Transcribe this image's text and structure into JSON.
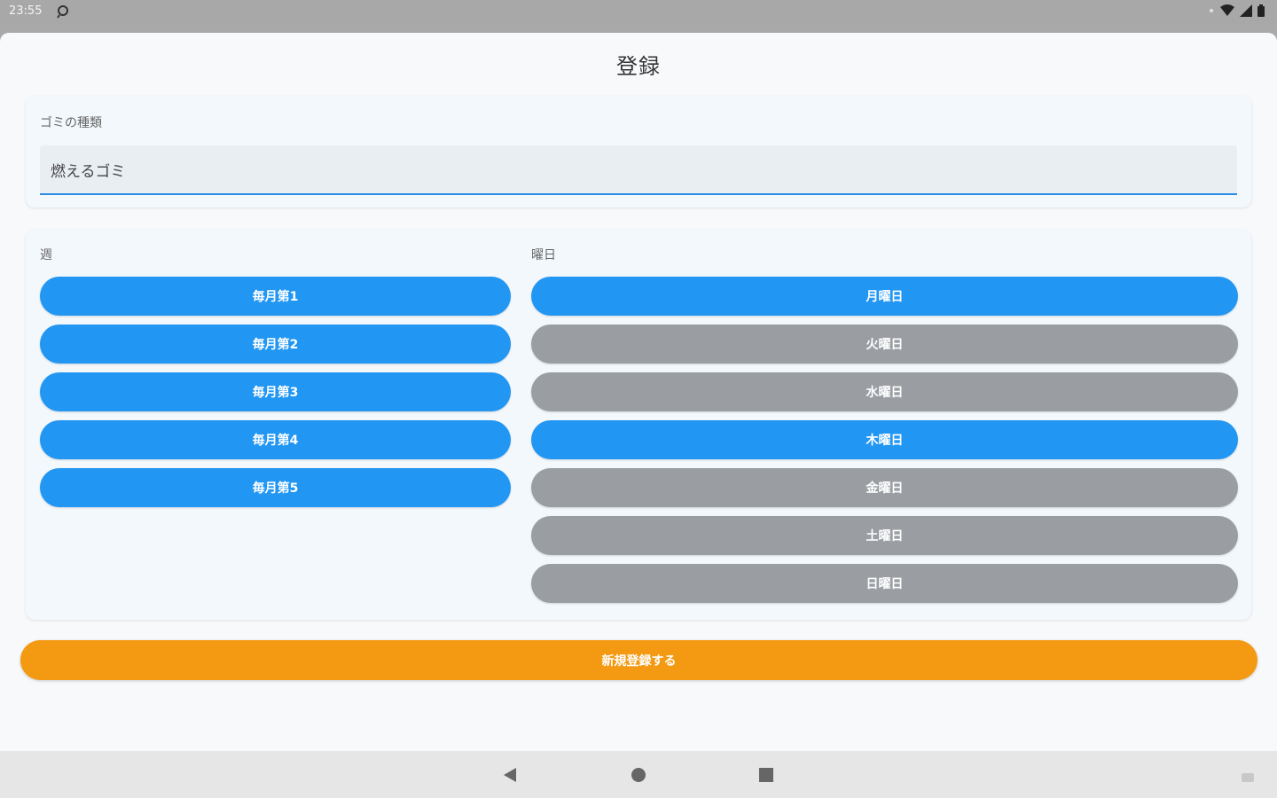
{
  "status_bar": {
    "time": "23:55",
    "left_icon": "sync-icon",
    "right_icons": [
      "notification-dot-icon",
      "wifi-icon",
      "signal-icon",
      "battery-icon"
    ]
  },
  "page": {
    "title": "登録"
  },
  "garbage_type": {
    "label": "ゴミの種類",
    "value": "燃えるゴミ"
  },
  "week": {
    "label": "週",
    "options": [
      {
        "label": "毎月第1",
        "selected": true
      },
      {
        "label": "毎月第2",
        "selected": true
      },
      {
        "label": "毎月第3",
        "selected": true
      },
      {
        "label": "毎月第4",
        "selected": true
      },
      {
        "label": "毎月第5",
        "selected": true
      }
    ]
  },
  "weekday": {
    "label": "曜日",
    "options": [
      {
        "label": "月曜日",
        "selected": true
      },
      {
        "label": "火曜日",
        "selected": false
      },
      {
        "label": "水曜日",
        "selected": false
      },
      {
        "label": "木曜日",
        "selected": true
      },
      {
        "label": "金曜日",
        "selected": false
      },
      {
        "label": "土曜日",
        "selected": false
      },
      {
        "label": "日曜日",
        "selected": false
      }
    ]
  },
  "submit": {
    "label": "新規登録する"
  },
  "nav_bar": {
    "icons": [
      "back-icon",
      "home-icon",
      "recents-icon",
      "keyboard-icon"
    ]
  },
  "colors": {
    "selected": "#2196f3",
    "unselected": "#9a9ea3",
    "submit": "#f39a12",
    "field_underline": "#2a8be6"
  }
}
